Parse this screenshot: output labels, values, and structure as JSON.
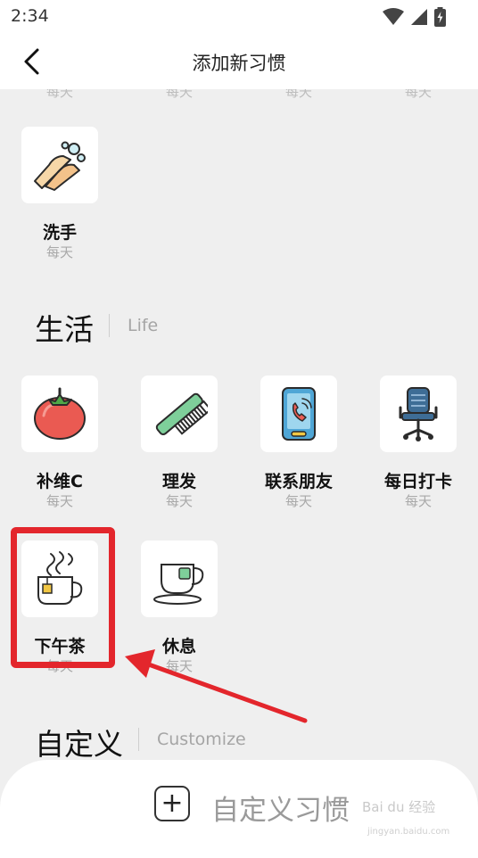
{
  "status": {
    "time": "2:34"
  },
  "nav": {
    "title": "添加新习惯"
  },
  "cut_row": [
    "每天",
    "每天",
    "每天",
    "每天"
  ],
  "hygiene": [
    {
      "name": "洗手",
      "freq": "每天",
      "icon": "hand-washing-icon"
    }
  ],
  "life_section": {
    "title": "生活",
    "subtitle": "Life",
    "habits": [
      {
        "name": "补维C",
        "freq": "每天",
        "icon": "tomato-icon"
      },
      {
        "name": "理发",
        "freq": "每天",
        "icon": "comb-icon"
      },
      {
        "name": "联系朋友",
        "freq": "每天",
        "icon": "phone-icon"
      },
      {
        "name": "每日打卡",
        "freq": "每天",
        "icon": "office-chair-icon"
      },
      {
        "name": "下午茶",
        "freq": "每天",
        "icon": "hot-tea-cup-icon"
      },
      {
        "name": "休息",
        "freq": "每天",
        "icon": "teacup-icon"
      }
    ]
  },
  "custom_section": {
    "title": "自定义",
    "subtitle": "Customize"
  },
  "bottom": {
    "add_label": "自定义习惯",
    "watermark": "Bai du 经验",
    "watermark_sub": "jingyan.baidu.com"
  },
  "colors": {
    "highlight": "#e3262c",
    "background": "#efefef"
  }
}
